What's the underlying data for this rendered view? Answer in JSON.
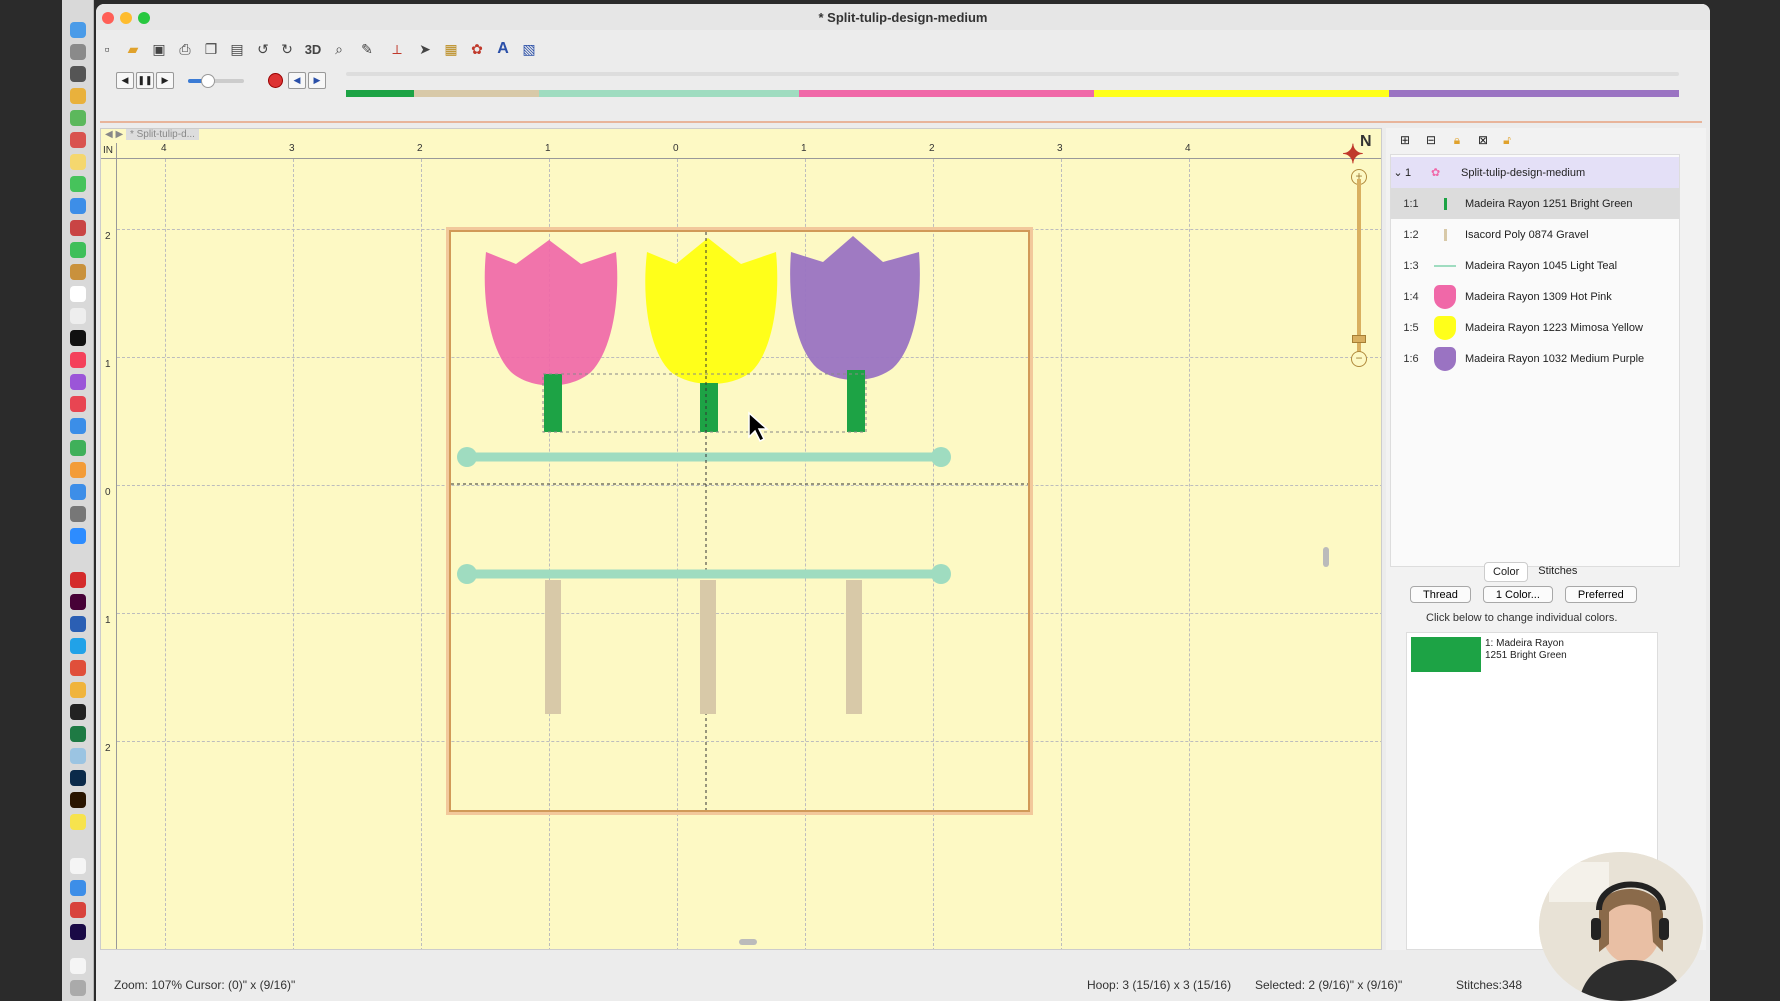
{
  "window": {
    "title": "* Split-tulip-design-medium"
  },
  "colors": {
    "accent": "#5fa8e8",
    "bright_green": "#1da345",
    "gravel": "#d8c9a8",
    "light_teal": "#9fdcc0",
    "hot_pink": "#f068a8",
    "mimosa_yellow": "#ffff1a",
    "medium_purple": "#9a73c2",
    "canvas": "#fdf9c4"
  },
  "toolbar": {
    "icons": [
      "new-icon",
      "open-icon",
      "save-icon",
      "print-icon",
      "copy-icon",
      "paste-icon",
      "rotate-left-icon",
      "rotate-right-icon",
      "3d-icon",
      "magnify-icon",
      "measure-icon",
      "split-icon",
      "select-arrow-icon",
      "block-icon",
      "mask-icon",
      "text-A-icon",
      "export-icon"
    ],
    "three_d_label": "3D",
    "text_label": "A"
  },
  "playbar": {
    "prev_label": "◀",
    "pause_label": "❚❚",
    "next_label": "▶",
    "stop_label": "■",
    "back_label": "◀",
    "fwd_label": "▶",
    "speed_level": 0.35
  },
  "tab": {
    "label": "* Split-tulip-d..."
  },
  "ruler": {
    "unit": "IN",
    "h_labels": [
      "4",
      "3",
      "2",
      "1",
      "0",
      "1",
      "2",
      "3",
      "4"
    ],
    "v_labels": [
      "2",
      "1",
      "0",
      "1",
      "2"
    ]
  },
  "compass": {
    "label": "N"
  },
  "zoom": {
    "plus": "+",
    "minus": "−"
  },
  "layers": {
    "design": {
      "num": "1",
      "name": "Split-tulip-design-medium"
    },
    "items": [
      {
        "num": "1:1",
        "name": "Madeira Rayon 1251 Bright Green"
      },
      {
        "num": "1:2",
        "name": "Isacord Poly 0874 Gravel"
      },
      {
        "num": "1:3",
        "name": "Madeira Rayon 1045 Light Teal"
      },
      {
        "num": "1:4",
        "name": "Madeira Rayon 1309 Hot Pink"
      },
      {
        "num": "1:5",
        "name": "Madeira Rayon 1223 Mimosa Yellow"
      },
      {
        "num": "1:6",
        "name": "Madeira Rayon 1032 Medium Purple"
      }
    ]
  },
  "color_panel": {
    "tabs": [
      "Color",
      "Stitches"
    ],
    "buttons": [
      "Thread",
      "1 Color...",
      "Preferred"
    ],
    "hint": "Click below to change individual colors.",
    "selected_color": {
      "line1": "1: Madeira Rayon",
      "line2": "1251 Bright Green"
    }
  },
  "status": {
    "zoom_cursor": "Zoom: 107%  Cursor: (0)\" x (9/16)\"",
    "hoop": "Hoop: 3 (15/16) x 3 (15/16)",
    "selected": "Selected: 2 (9/16)\" x (9/16)\"",
    "stitches": "Stitches:348"
  }
}
